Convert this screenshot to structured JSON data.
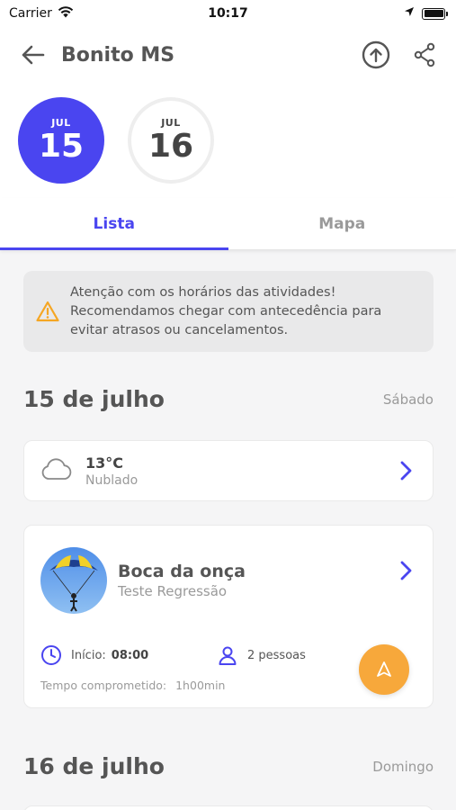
{
  "status_bar": {
    "carrier": "Carrier",
    "time": "10:17"
  },
  "header": {
    "title": "Bonito MS",
    "back_icon": "arrow-left-icon",
    "upload_icon": "upload-circle-icon",
    "share_icon": "share-icon"
  },
  "dates": [
    {
      "month": "JUL",
      "day": "15",
      "active": true
    },
    {
      "month": "JUL",
      "day": "16",
      "active": false
    }
  ],
  "tabs": [
    {
      "label": "Lista",
      "active": true
    },
    {
      "label": "Mapa",
      "active": false
    }
  ],
  "notice": {
    "icon": "warning-icon",
    "line1": "Atenção com os horários das atividades!",
    "line2": "Recomendamos chegar com antecedência para",
    "line3": "evitar atrasos ou cancelamentos."
  },
  "days": [
    {
      "title": "15 de julho",
      "weekday": "Sábado",
      "weather": {
        "temp": "13°C",
        "desc": "Nublado",
        "icon": "cloud-icon"
      },
      "activities": [
        {
          "title": "Boca da onça",
          "subtitle": "Teste Regressão",
          "start_label": "Início:",
          "start_time": "08:00",
          "people": "2 pessoas",
          "committed_label": "Tempo comprometido:",
          "committed_value": "1h00min"
        }
      ]
    },
    {
      "title": "16 de julho",
      "weekday": "Domingo"
    }
  ],
  "colors": {
    "accent": "#4a45f0",
    "fab": "#f7a83b",
    "warning": "#f5a623"
  }
}
